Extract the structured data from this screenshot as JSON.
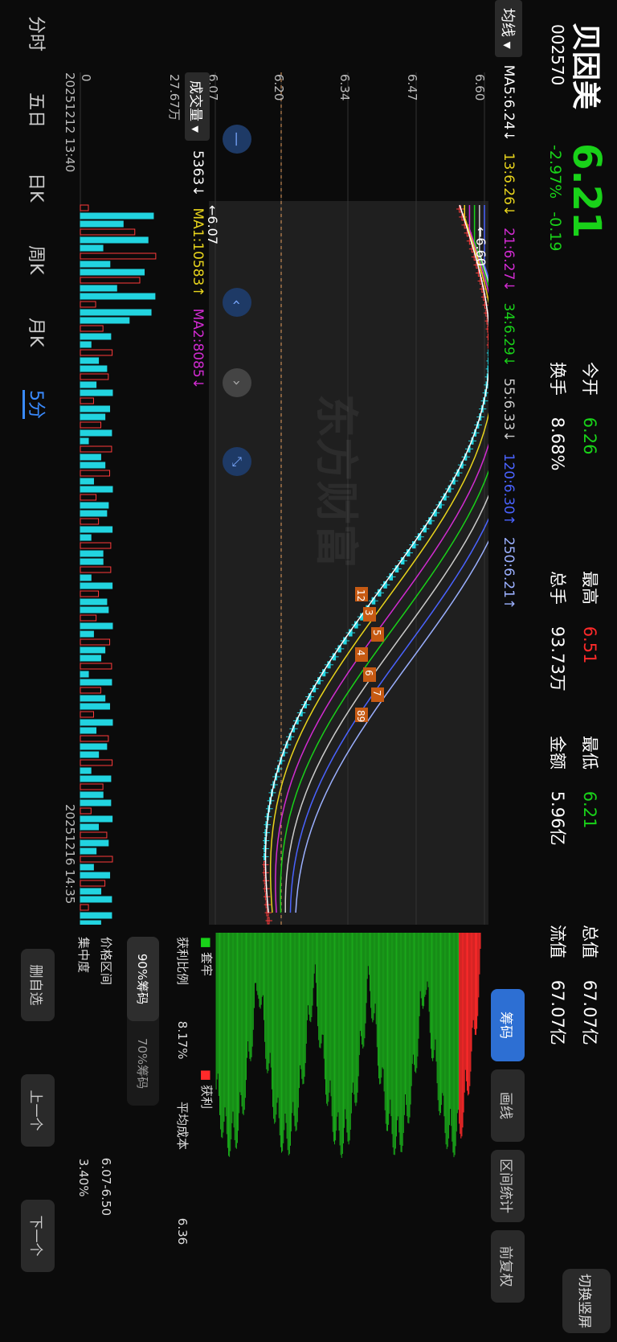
{
  "stock": {
    "name": "贝因美",
    "code": "002570",
    "price": "6.21",
    "change_pct": "-2.97%",
    "change": "-0.19"
  },
  "stats": [
    {
      "label": "今开",
      "value": "6.26",
      "color": "#19d219"
    },
    {
      "label": "最高",
      "value": "6.51",
      "color": "#ff2a2a"
    },
    {
      "label": "最低",
      "value": "6.21",
      "color": "#19d219"
    },
    {
      "label": "换手",
      "value": "8.68%",
      "color": "#ffffff"
    },
    {
      "label": "总手",
      "value": "93.73万",
      "color": "#ffffff"
    },
    {
      "label": "金额",
      "value": "5.96亿",
      "color": "#ffffff"
    },
    {
      "label": "总值",
      "value": "67.07亿",
      "color": "#ffffff"
    },
    {
      "label": "流值",
      "value": "67.07亿",
      "color": "#ffffff"
    }
  ],
  "switch_button": "切换竖屏",
  "ma_bar": {
    "selector": "均线",
    "items": [
      {
        "text": "MA5:6.24↓",
        "color": "#ffffff"
      },
      {
        "text": "13:6.26↓",
        "color": "#e8d41c"
      },
      {
        "text": "21:6.27↓",
        "color": "#d22bd2"
      },
      {
        "text": "34:6.29↓",
        "color": "#19d219"
      },
      {
        "text": "55:6.33↓",
        "color": "#cccccc"
      },
      {
        "text": "120:6.30↑",
        "color": "#4a63ff"
      },
      {
        "text": "250:6.21↑",
        "color": "#9bb0ff"
      }
    ]
  },
  "price_axis": [
    "6.60",
    "6.47",
    "6.34",
    "6.20",
    "6.07"
  ],
  "annotations": {
    "high": "←6.60",
    "low": "←6.07"
  },
  "watermark": "东方财富",
  "volume_bar": {
    "selector": "成交量",
    "items": [
      {
        "text": "5363↓",
        "color": "#ffffff"
      },
      {
        "text": "MA1:10583↑",
        "color": "#e8d41c"
      },
      {
        "text": "MA2:8085↓",
        "color": "#d22bd2"
      }
    ],
    "axis_top": "27.67万",
    "axis_bottom": "0"
  },
  "date_start": "20251212 13:40",
  "date_end": "20251216 14:35",
  "tabs": [
    {
      "label": "分时"
    },
    {
      "label": "五日"
    },
    {
      "label": "日K"
    },
    {
      "label": "周K"
    },
    {
      "label": "月K"
    },
    {
      "label": "5分"
    }
  ],
  "bottom_buttons": [
    "删自选",
    "上一个",
    "下一个"
  ],
  "chip_panel": {
    "tools": [
      "筹码",
      "画线",
      "区间统计",
      "前复权"
    ],
    "legend_loss": "套牢",
    "legend_profit": "获利",
    "profit_ratio_label": "获利比例",
    "profit_ratio": "8.17%",
    "avg_cost_label": "平均成本",
    "avg_cost": "6.36",
    "seg_a": "90%筹码",
    "seg_b": "70%筹码",
    "range_label": "价格区间",
    "range": "6.07-6.50",
    "conc_label": "集中度",
    "conc": "3.40%"
  },
  "badges": [
    "12",
    "3",
    "5",
    "4",
    "6",
    "7",
    "89"
  ]
}
